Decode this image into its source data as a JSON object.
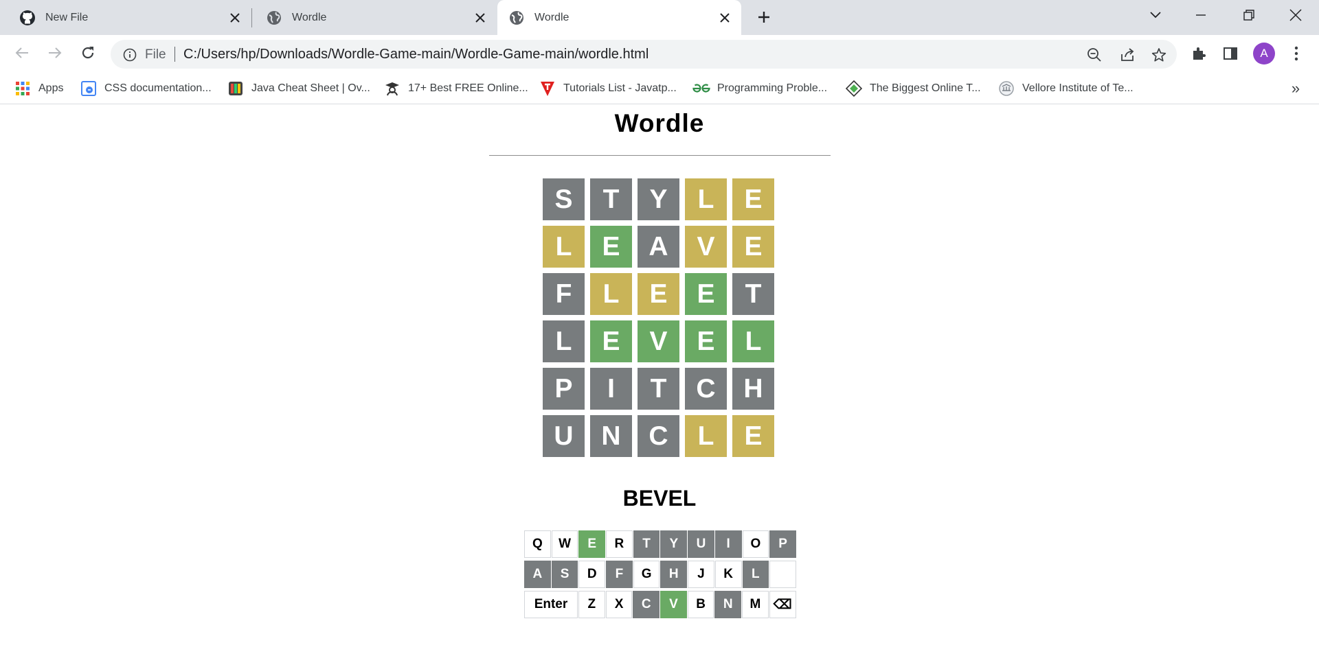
{
  "browser": {
    "tabs": [
      {
        "title": "New File",
        "icon": "github-icon",
        "active": false
      },
      {
        "title": "Wordle",
        "icon": "globe-icon",
        "active": false
      },
      {
        "title": "Wordle",
        "icon": "globe-icon",
        "active": true
      }
    ],
    "omnibox": {
      "scheme_label": "File",
      "url": "C:/Users/hp/Downloads/Wordle-Game-main/Wordle-Game-main/wordle.html"
    },
    "avatar_letter": "A",
    "bookmarks": [
      {
        "label": "Apps",
        "icon": "apps-grid-icon"
      },
      {
        "label": "CSS documentation...",
        "icon": "css-docs-icon"
      },
      {
        "label": "Java Cheat Sheet | Ov...",
        "icon": "book-icon"
      },
      {
        "label": "17+ Best FREE Online...",
        "icon": "graduate-icon"
      },
      {
        "label": "Tutorials List - Javatp...",
        "icon": "javatpoint-icon"
      },
      {
        "label": "Programming Proble...",
        "icon": "geeksforgeeks-icon"
      },
      {
        "label": "The Biggest Online T...",
        "icon": "diamond-icon"
      },
      {
        "label": "Vellore Institute of Te...",
        "icon": "university-seal-icon"
      }
    ],
    "bookmarks_overflow": "»"
  },
  "game": {
    "title": "Wordle",
    "answer": "BEVEL",
    "colors": {
      "absent": "#787c7e",
      "present": "#c9b458",
      "correct": "#6aaa64"
    },
    "board": [
      [
        {
          "letter": "S",
          "state": "absent"
        },
        {
          "letter": "T",
          "state": "absent"
        },
        {
          "letter": "Y",
          "state": "absent"
        },
        {
          "letter": "L",
          "state": "present"
        },
        {
          "letter": "E",
          "state": "present"
        }
      ],
      [
        {
          "letter": "L",
          "state": "present"
        },
        {
          "letter": "E",
          "state": "correct"
        },
        {
          "letter": "A",
          "state": "absent"
        },
        {
          "letter": "V",
          "state": "present"
        },
        {
          "letter": "E",
          "state": "present"
        }
      ],
      [
        {
          "letter": "F",
          "state": "absent"
        },
        {
          "letter": "L",
          "state": "present"
        },
        {
          "letter": "E",
          "state": "present"
        },
        {
          "letter": "E",
          "state": "correct"
        },
        {
          "letter": "T",
          "state": "absent"
        }
      ],
      [
        {
          "letter": "L",
          "state": "absent"
        },
        {
          "letter": "E",
          "state": "correct"
        },
        {
          "letter": "V",
          "state": "correct"
        },
        {
          "letter": "E",
          "state": "correct"
        },
        {
          "letter": "L",
          "state": "correct"
        }
      ],
      [
        {
          "letter": "P",
          "state": "absent"
        },
        {
          "letter": "I",
          "state": "absent"
        },
        {
          "letter": "T",
          "state": "absent"
        },
        {
          "letter": "C",
          "state": "absent"
        },
        {
          "letter": "H",
          "state": "absent"
        }
      ],
      [
        {
          "letter": "U",
          "state": "absent"
        },
        {
          "letter": "N",
          "state": "absent"
        },
        {
          "letter": "C",
          "state": "absent"
        },
        {
          "letter": "L",
          "state": "present"
        },
        {
          "letter": "E",
          "state": "present"
        }
      ]
    ],
    "keyboard": [
      [
        {
          "label": "Q",
          "state": "unused"
        },
        {
          "label": "W",
          "state": "unused"
        },
        {
          "label": "E",
          "state": "correct"
        },
        {
          "label": "R",
          "state": "unused"
        },
        {
          "label": "T",
          "state": "absent"
        },
        {
          "label": "Y",
          "state": "absent"
        },
        {
          "label": "U",
          "state": "absent"
        },
        {
          "label": "I",
          "state": "absent"
        },
        {
          "label": "O",
          "state": "unused"
        },
        {
          "label": "P",
          "state": "absent"
        }
      ],
      [
        {
          "label": "A",
          "state": "absent"
        },
        {
          "label": "S",
          "state": "absent"
        },
        {
          "label": "D",
          "state": "unused"
        },
        {
          "label": "F",
          "state": "absent"
        },
        {
          "label": "G",
          "state": "unused"
        },
        {
          "label": "H",
          "state": "absent"
        },
        {
          "label": "J",
          "state": "unused"
        },
        {
          "label": "K",
          "state": "unused"
        },
        {
          "label": "L",
          "state": "absent"
        },
        {
          "label": "",
          "state": "unused"
        }
      ],
      [
        {
          "label": "Enter",
          "state": "unused",
          "wide": true
        },
        {
          "label": "Z",
          "state": "unused"
        },
        {
          "label": "X",
          "state": "unused"
        },
        {
          "label": "C",
          "state": "absent"
        },
        {
          "label": "V",
          "state": "correct"
        },
        {
          "label": "B",
          "state": "unused"
        },
        {
          "label": "N",
          "state": "absent"
        },
        {
          "label": "M",
          "state": "unused"
        },
        {
          "label": "⌫",
          "state": "unused"
        }
      ]
    ]
  }
}
